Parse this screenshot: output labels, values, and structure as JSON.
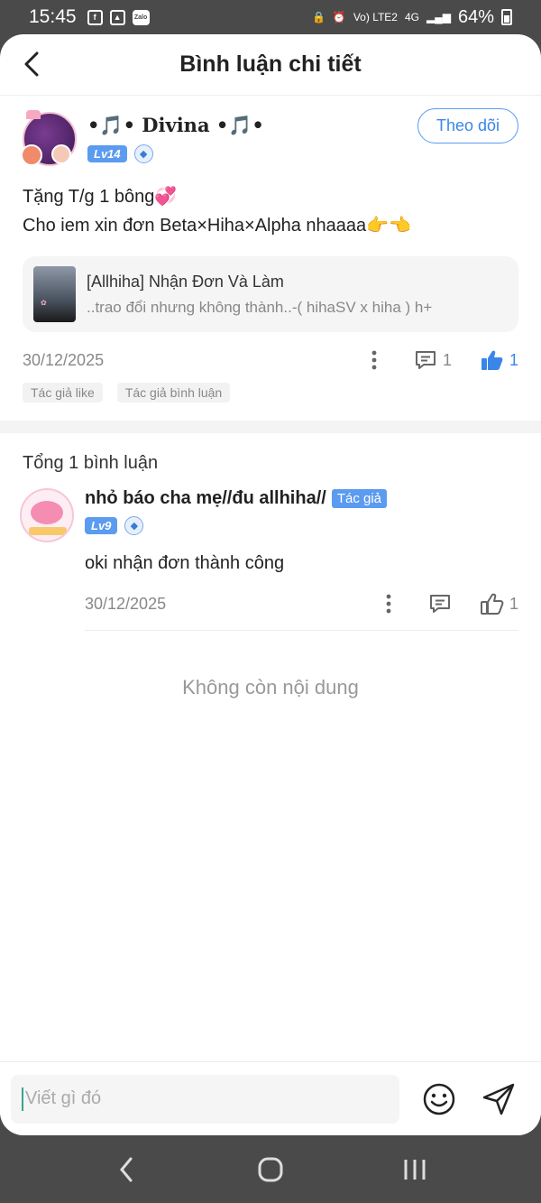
{
  "status_bar": {
    "time": "15:45",
    "battery": "64%",
    "network": "4G",
    "lte": "Vo) LTE2",
    "zalo": "Zalo"
  },
  "header": {
    "title": "Bình luận chi tiết"
  },
  "main_comment": {
    "username": "•🎵• Divina •🎵•",
    "level": "Lv14",
    "follow_label": "Theo dõi",
    "text_line1": "Tặng T/g 1 bông💞",
    "text_line2": "Cho iem xin đơn Beta×Hiha×Alpha nhaaaa👉👈",
    "linked_post": {
      "title": "[Allhiha] Nhận Đơn Và Làm",
      "subtitle": "..trao đổi nhưng không thành..-( hihaSV x hiha ) h+"
    },
    "date": "30/12/2025",
    "comment_count": "1",
    "like_count": "1",
    "tags": [
      "Tác giả like",
      "Tác giả bình luận"
    ]
  },
  "replies_section": {
    "total_label": "Tổng 1 bình luận",
    "replies": [
      {
        "username": "nhỏ báo cha mẹ//đu allhiha//",
        "author_badge": "Tác giả",
        "level": "Lv9",
        "text": "oki nhận đơn thành công",
        "date": "30/12/2025",
        "like_count": "1"
      }
    ]
  },
  "no_more_label": "Không còn nội dung",
  "input": {
    "placeholder": "Viết gì đó"
  },
  "icons": {
    "back": "back-arrow-icon",
    "more": "more-vertical-icon",
    "comment": "comment-icon",
    "like": "thumbs-up-icon",
    "emoji": "emoji-icon",
    "send": "send-icon"
  },
  "colors": {
    "accent": "#3a86e8",
    "level_badge": "#5b9bf0",
    "muted": "#888888"
  }
}
